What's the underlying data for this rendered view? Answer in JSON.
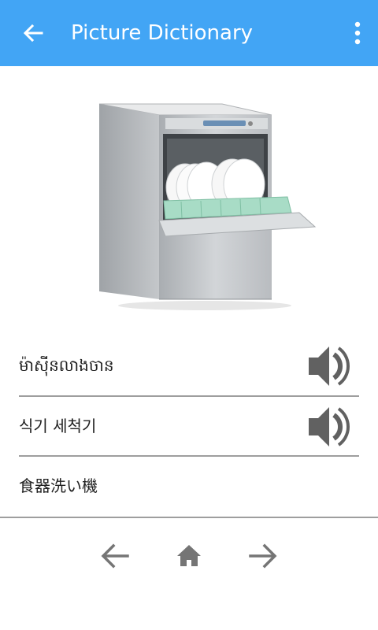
{
  "app_bar": {
    "title": "Picture Dictionary",
    "back_icon": "arrow-left-icon",
    "menu_icon": "more-vertical-icon",
    "color": "#42a5f5"
  },
  "image": {
    "subject": "dishwasher-icon"
  },
  "words": [
    {
      "text": "ម៉ាស៊ីនលាងចាន",
      "has_audio": true
    },
    {
      "text": "식기 세척기",
      "has_audio": true
    },
    {
      "text": "食器洗い機",
      "has_audio": false
    }
  ],
  "bottom_nav": {
    "prev_icon": "arrow-left-icon",
    "home_icon": "home-icon",
    "next_icon": "arrow-right-icon",
    "icon_color": "#757575"
  }
}
